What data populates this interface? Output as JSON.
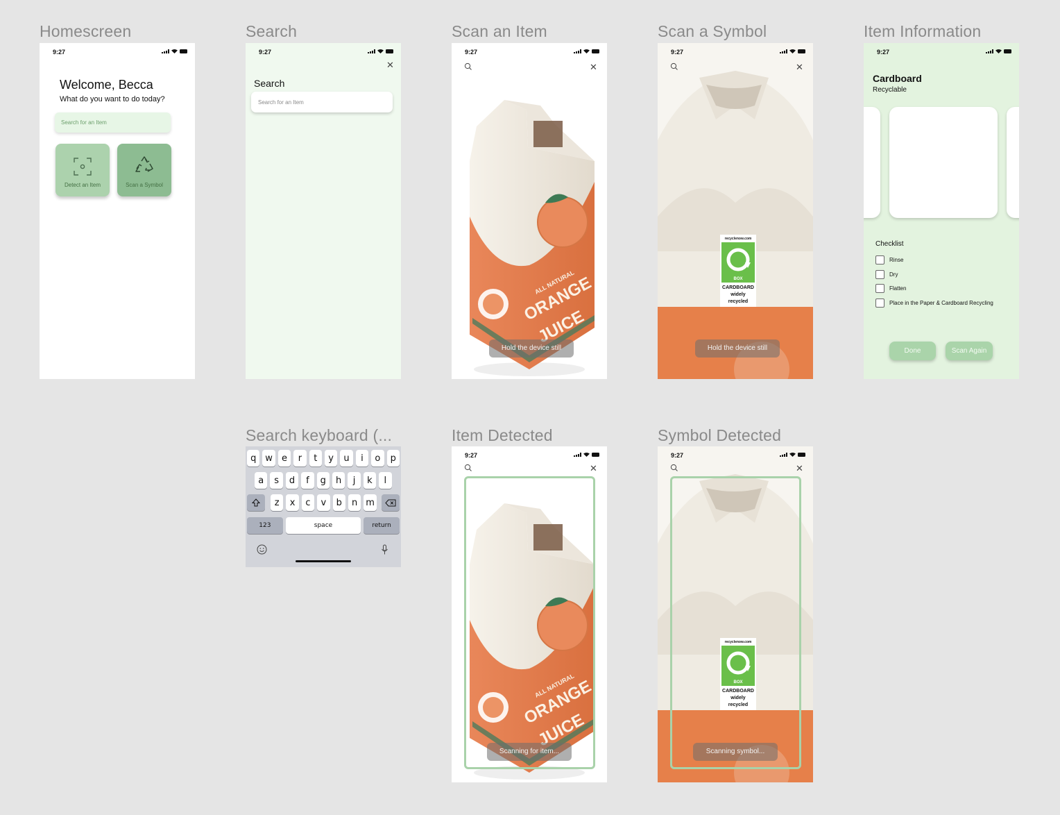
{
  "status": {
    "time": "9:27"
  },
  "labels": {
    "homescreen": "Homescreen",
    "search": "Search",
    "scan_item": "Scan an Item",
    "scan_symbol": "Scan a Symbol",
    "item_info": "Item Information",
    "keyboard": "Search keyboard (...",
    "item_detected": "Item Detected",
    "symbol_detected": "Symbol Detected"
  },
  "home": {
    "welcome": "Welcome, Becca",
    "question": "What do you want to do today?",
    "search_placeholder": "Search for an Item",
    "detect_label": "Detect an Item",
    "scan_label": "Scan a Symbol",
    "detect_icon": "scan-frame-icon",
    "scan_icon": "recycle-icon"
  },
  "search": {
    "title": "Search",
    "placeholder": "Search for an Item"
  },
  "carton": {
    "all_natural": "ALL NATURAL",
    "orange": "ORANGE",
    "juice": "JUICE"
  },
  "symbol": {
    "site": "recyclenow.com",
    "box": "BOX",
    "line1": "CARDBOARD",
    "line2": "widely",
    "line3": "recycled"
  },
  "scan": {
    "hold_still": "Hold the device still",
    "scanning_item": "Scanning for item...",
    "scanning_symbol": "Scanning symbol..."
  },
  "info": {
    "title": "Cardboard",
    "subtitle": "Recyclable",
    "checklist_title": "Checklist",
    "checklist": [
      "Rinse",
      "Dry",
      "Flatten",
      "Place in the Paper & Cardboard Recycling"
    ],
    "done": "Done",
    "scan_again": "Scan Again"
  },
  "keyboard": {
    "row1": [
      "q",
      "w",
      "e",
      "r",
      "t",
      "y",
      "u",
      "i",
      "o",
      "p"
    ],
    "row2": [
      "a",
      "s",
      "d",
      "f",
      "g",
      "h",
      "j",
      "k",
      "l"
    ],
    "row3": [
      "z",
      "x",
      "c",
      "v",
      "b",
      "n",
      "m"
    ],
    "numbers": "123",
    "space": "space",
    "return": "return"
  },
  "colors": {
    "accent": "#aad4aa",
    "tile_light": "#acd2ad",
    "tile_dark": "#8dbc92",
    "mint_bg": "#f0f9ef",
    "green_bg": "#e3f3df"
  }
}
